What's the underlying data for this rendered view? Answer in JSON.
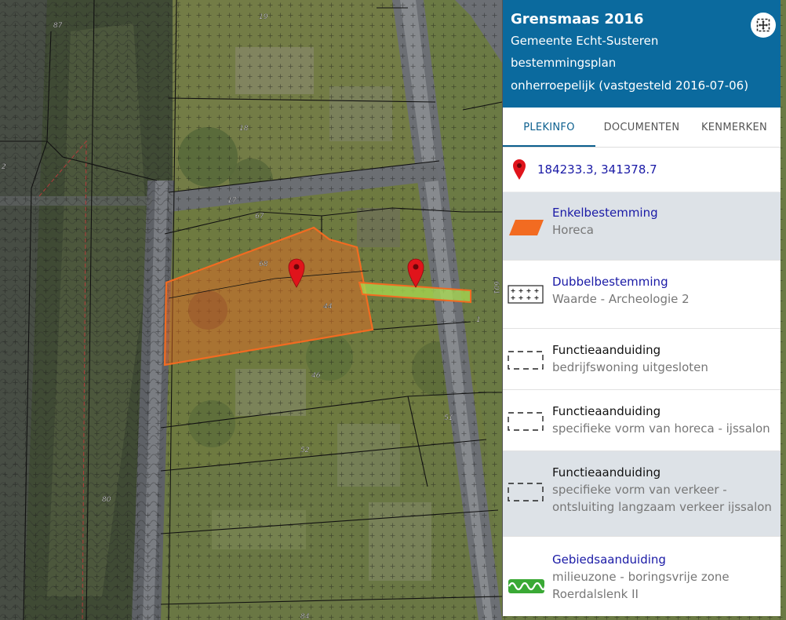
{
  "map": {
    "parcel_numbers": [
      "87",
      "19",
      "18",
      "17",
      "67",
      "68",
      "44",
      "46",
      "51",
      "52",
      "80",
      "84",
      "1",
      "601",
      "2"
    ]
  },
  "panel": {
    "title": "Grensmaas 2016",
    "municipality": "Gemeente Echt-Susteren",
    "plan_type": "bestemmingsplan",
    "status": "onherroepelijk (vastgesteld 2016-07-06)",
    "fullscreen_icon": "fullscreen-icon",
    "tabs": [
      {
        "label": "PLEKINFO",
        "active": true
      },
      {
        "label": "DOCUMENTEN",
        "active": false
      },
      {
        "label": "KENMERKEN",
        "active": false
      }
    ],
    "coordinates": "184233.3, 341378.7",
    "entries": [
      {
        "title": "Enkelbestemming",
        "sub": "Horeca",
        "icon": "parallelogram-icon"
      },
      {
        "title": "Dubbelbestemming",
        "sub": "Waarde - Archeologie 2",
        "icon": "crosses-icon"
      },
      {
        "title": "Functieaanduiding",
        "sub": "bedrijfswoning uitgesloten",
        "icon": "dashed-rect-icon"
      },
      {
        "title": "Functieaanduiding",
        "sub": "specifieke vorm van horeca - ijssalon",
        "icon": "dashed-rect-icon"
      },
      {
        "title": "Functieaanduiding",
        "sub1": "specifieke vorm van verkeer -",
        "sub2": "ontsluiting langzaam verkeer ijssalon",
        "icon": "dashed-rect-icon"
      },
      {
        "title": "Gebiedsaanduiding",
        "sub1": "milieuzone - boringsvrije zone",
        "sub2": "Roerdalslenk II",
        "icon": "green-wave-icon"
      }
    ]
  },
  "colors": {
    "header_bg": "#0b6a9e",
    "link_text": "#1a1aa6",
    "horeca_orange": "#f26b21",
    "marker_red": "#e0141b"
  }
}
